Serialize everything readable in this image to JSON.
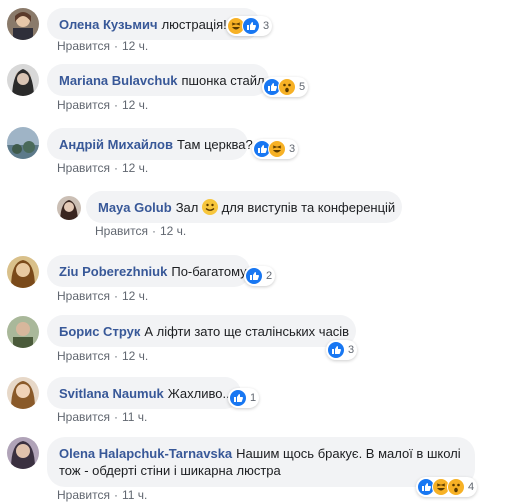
{
  "comments": [
    {
      "author": "Олена Кузьмич",
      "text": "люстрація!",
      "like": "Нравится",
      "time": "12 ч.",
      "count": "3"
    },
    {
      "author": "Mariana Bulavchuk",
      "text": "пшонка стайл",
      "like": "Нравится",
      "time": "12 ч.",
      "count": "5"
    },
    {
      "author": "Андрій Михайлов",
      "text": "Там церква?",
      "like": "Нравится",
      "time": "12 ч.",
      "count": "3"
    },
    {
      "author": "Maya Golub",
      "text_before": "Зал",
      "text_after": "для виступів та конференцій",
      "like": "Нравится",
      "time": "12 ч."
    },
    {
      "author": "Ziu Poberezhniuk",
      "text": "По-багатому",
      "like": "Нравится",
      "time": "12 ч.",
      "count": "2"
    },
    {
      "author": "Борис Струк",
      "text": "А ліфти зато ще сталінських часів",
      "like": "Нравится",
      "time": "12 ч.",
      "count": "3"
    },
    {
      "author": "Svitlana Naumuk",
      "text": "Жахливо...",
      "like": "Нравится",
      "time": "11 ч.",
      "count": "1"
    },
    {
      "author": "Olena Halapchuk-Tarnavska",
      "text": "Нашим щось бракує. В малої в школі тож - обдерті стіни і шикарна люстра",
      "like": "Нравится",
      "time": "11 ч.",
      "count": "4"
    }
  ],
  "colors": {
    "author": "#385898",
    "bubble": "#f2f3f5",
    "like": "#1877f2",
    "emoji": "#f7b125"
  }
}
